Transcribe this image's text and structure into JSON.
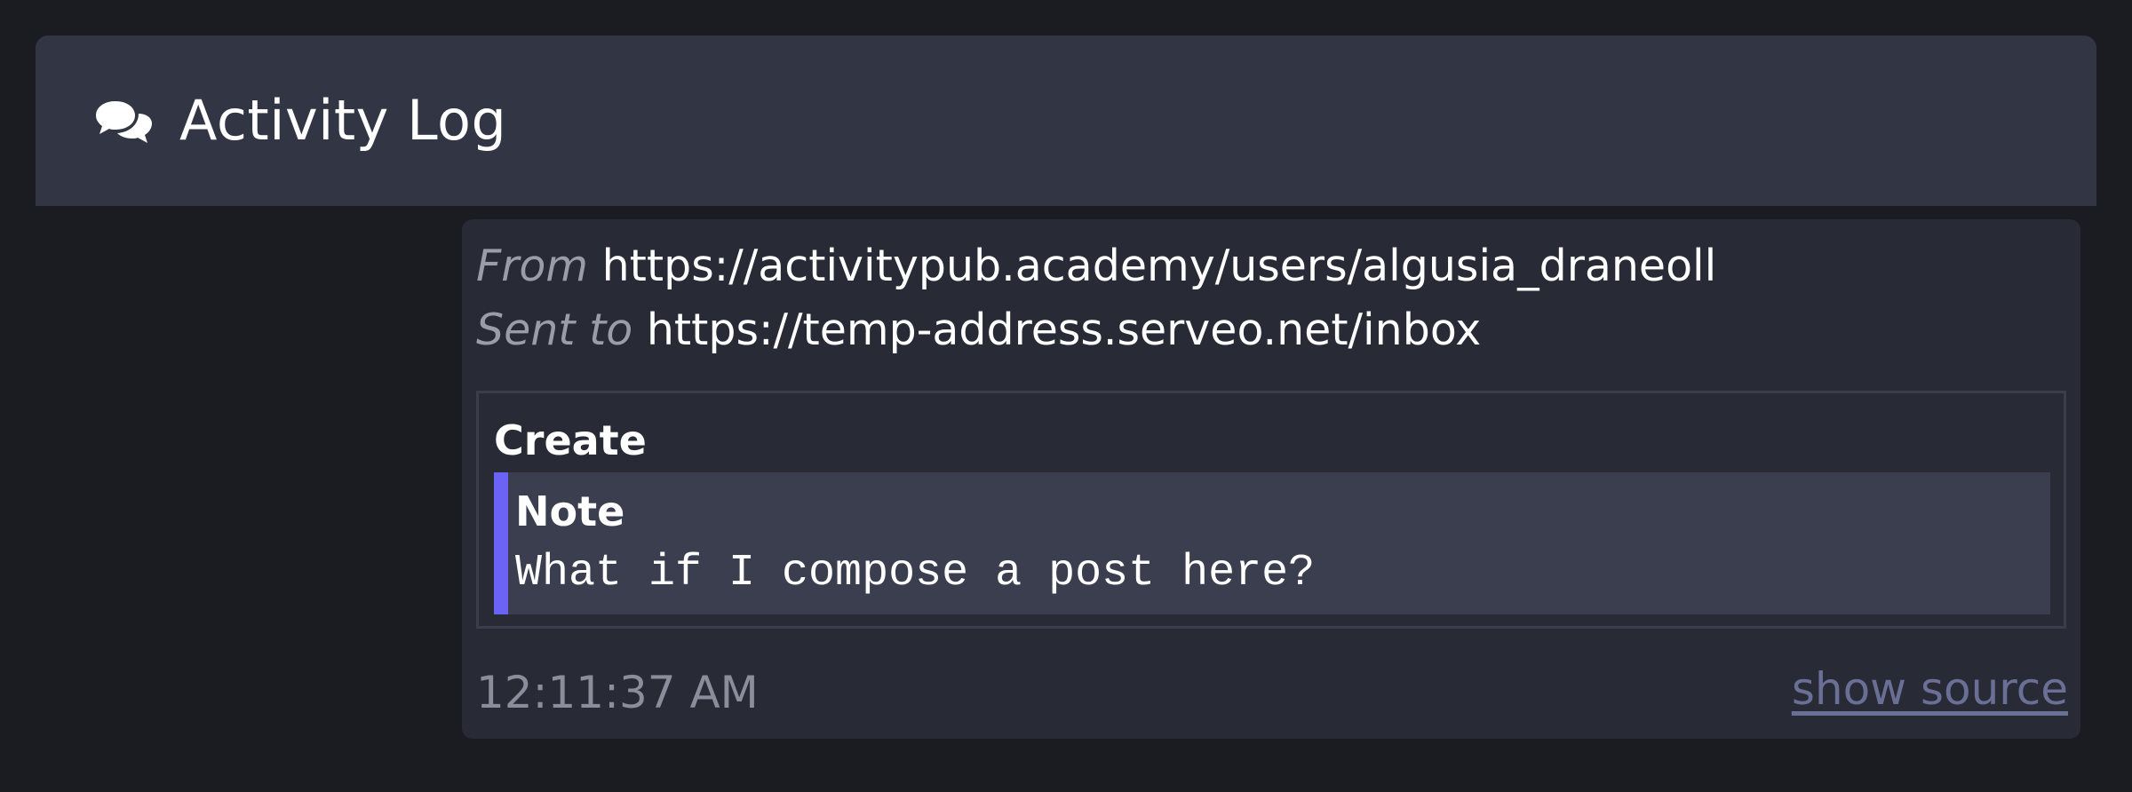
{
  "header": {
    "title": "Activity Log",
    "icon": "comments-icon"
  },
  "activity": {
    "from_label": "From",
    "from_value": "https://activitypub.academy/users/algusia_draneoll",
    "sent_label": "Sent to",
    "sent_value": "https://temp-address.serveo.net/inbox",
    "type": "Create",
    "object": {
      "type": "Note",
      "content": "What if I compose a post here?"
    },
    "timestamp": "12:11:37 AM",
    "show_source_label": "show source"
  },
  "colors": {
    "background": "#1a1c22",
    "header_bg": "#323544",
    "card_bg": "#282a36",
    "note_bg": "#3b3e4f",
    "accent": "#6a63f5",
    "muted_text": "#9a9ca8",
    "link": "#6a6f95"
  }
}
